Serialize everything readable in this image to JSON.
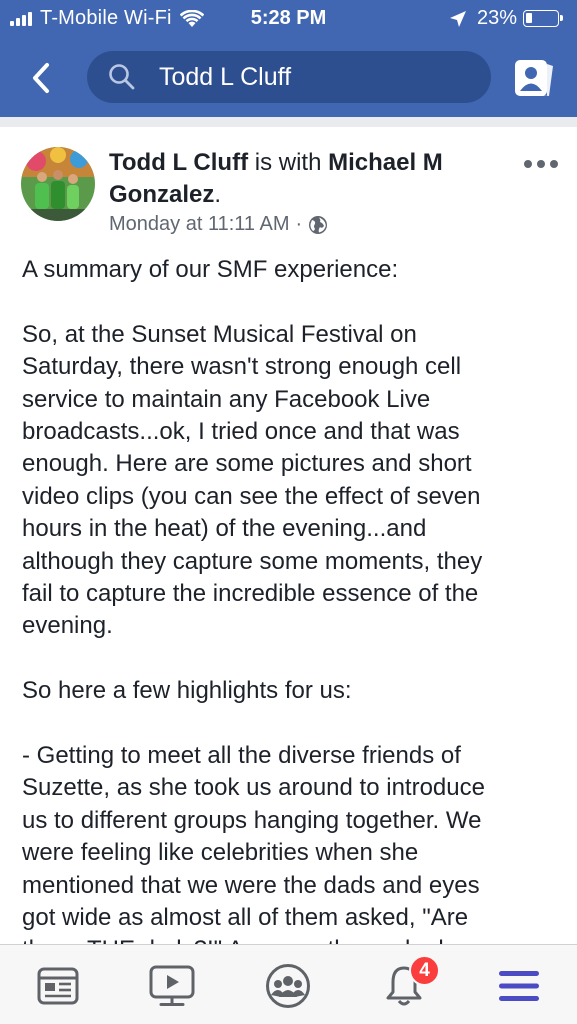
{
  "status_bar": {
    "carrier": "T-Mobile Wi-Fi",
    "time": "5:28 PM",
    "battery_percent": "23%",
    "battery_level": 0.23,
    "signal_bars": 4,
    "icons": [
      "signal-icon",
      "wifi-icon",
      "location-arrow-icon",
      "battery-icon"
    ]
  },
  "nav": {
    "back_icon": "chevron-left-icon",
    "search_icon": "search-icon",
    "search_value": "Todd L Cluff",
    "profile_icon": "profile-card-icon"
  },
  "post": {
    "author": "Todd L Cluff",
    "with_text": " is with ",
    "tagged": "Michael M Gonzalez",
    "period": ".",
    "timestamp": "Monday at 11:11 AM",
    "separator": "·",
    "privacy_icon": "globe-icon",
    "more_icon": "more-dots-icon",
    "paragraphs": [
      [
        "A summary of our SMF experience:"
      ],
      [
        "So, at the Sunset Musical Festival on",
        "Saturday, there wasn't strong enough cell",
        "service to maintain any Facebook Live",
        "broadcasts...ok, I tried once and that was",
        "enough. Here are some pictures and short",
        "video clips (you can see the effect of seven",
        "hours in the heat) of the evening...and",
        "although they capture some moments, they",
        "fail to capture the incredible essence of the",
        "evening."
      ],
      [
        "So here a few highlights for us:"
      ],
      [
        "- Getting to meet all the diverse friends of",
        "Suzette, as she took us around to introduce",
        "us to different groups hanging together. We",
        "were feeling like celebrities when she",
        "mentioned that we were the dads and eyes",
        "got wide as almost all of them asked, \"Are",
        "those THE dads?!\" As a gay they asked"
      ]
    ]
  },
  "tabbar": {
    "tabs": [
      "news-feed-icon",
      "watch-video-icon",
      "groups-icon",
      "notifications-bell-icon",
      "menu-icon"
    ],
    "notification_count": "4",
    "accent": "#4b4bc4"
  },
  "colors": {
    "brand_blue": "#4267b2",
    "search_bg": "#2e4f8f",
    "text": "#1d2129",
    "meta": "#606770",
    "badge": "#fa3e3e"
  }
}
